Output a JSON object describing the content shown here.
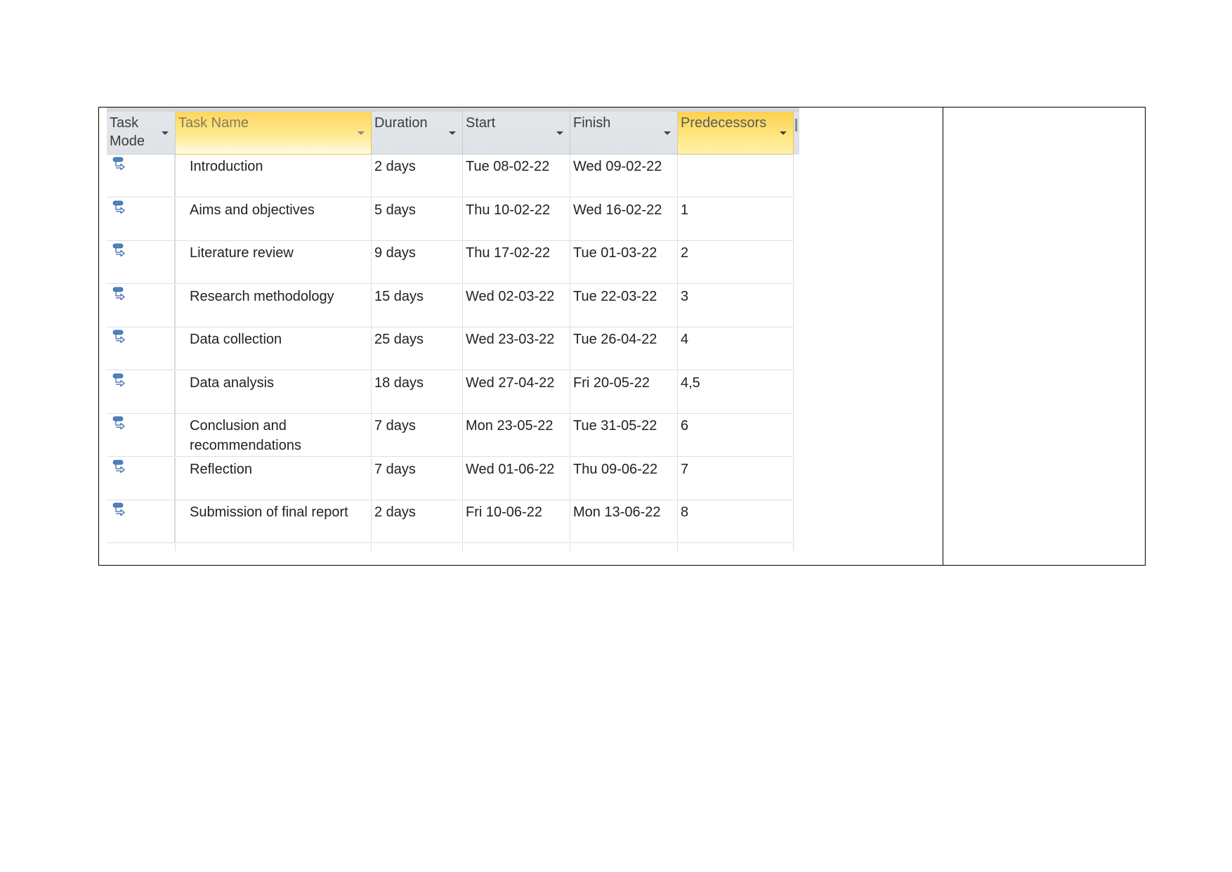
{
  "table": {
    "columns": [
      {
        "key": "mode",
        "label": "Task Mode",
        "selected": false
      },
      {
        "key": "name",
        "label": "Task Name",
        "selected": true
      },
      {
        "key": "duration",
        "label": "Duration",
        "selected": false
      },
      {
        "key": "start",
        "label": "Start",
        "selected": false
      },
      {
        "key": "finish",
        "label": "Finish",
        "selected": false
      },
      {
        "key": "predecessors",
        "label": "Predecessors",
        "selected": true
      }
    ],
    "header": {
      "mode_line1": "Task",
      "mode_line2": "Mode",
      "name": "Task Name",
      "duration": "Duration",
      "start": "Start",
      "finish": "Finish",
      "predecessors": "Predecessors"
    },
    "task_mode_icon": "auto-scheduled-task-icon",
    "rows": [
      {
        "name": "Introduction",
        "duration": "2 days",
        "start": "Tue 08-02-22",
        "finish": "Wed 09-02-22",
        "predecessors": ""
      },
      {
        "name": "Aims and objectives",
        "duration": "5 days",
        "start": "Thu 10-02-22",
        "finish": "Wed 16-02-22",
        "predecessors": "1"
      },
      {
        "name": "Literature review",
        "duration": "9 days",
        "start": "Thu 17-02-22",
        "finish": "Tue 01-03-22",
        "predecessors": "2"
      },
      {
        "name": "Research methodology",
        "duration": "15 days",
        "start": "Wed 02-03-22",
        "finish": "Tue 22-03-22",
        "predecessors": "3"
      },
      {
        "name": "Data collection",
        "duration": "25 days",
        "start": "Wed 23-03-22",
        "finish": "Tue 26-04-22",
        "predecessors": "4"
      },
      {
        "name": "Data analysis",
        "duration": "18 days",
        "start": "Wed 27-04-22",
        "finish": "Fri 20-05-22",
        "predecessors": "4,5"
      },
      {
        "name": "Conclusion and recommendations",
        "duration": "7 days",
        "start": "Mon 23-05-22",
        "finish": "Tue 31-05-22",
        "predecessors": "6"
      },
      {
        "name": "Reflection",
        "duration": "7 days",
        "start": "Wed 01-06-22",
        "finish": "Thu 09-06-22",
        "predecessors": "7"
      },
      {
        "name": "Submission of final report",
        "duration": "2 days",
        "start": "Fri 10-06-22",
        "finish": "Mon 13-06-22",
        "predecessors": "8"
      }
    ]
  },
  "colors": {
    "header_bg": "#dfe2e6",
    "selected_header_bg": "#fee67d",
    "grid_line": "#dcdee2",
    "icon_blue": "#4f81bd"
  }
}
